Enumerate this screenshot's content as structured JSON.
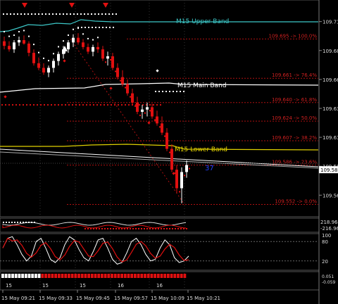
{
  "chart_data": {
    "type": "candlestick",
    "symbol_timeframe": "M15 style indicator view",
    "price_axis": {
      "range": [
        109.545,
        109.725
      ],
      "ticks": [
        "109.710",
        "109.685",
        "109.660",
        "109.635",
        "109.610",
        "109.585",
        "109.560"
      ],
      "current_price_label": "109.582"
    },
    "bands": [
      {
        "name": "M15 Upper Band",
        "color": "#3cc7c7"
      },
      {
        "name": "M15 Main Band",
        "color": "#ffffff"
      },
      {
        "name": "M15 Lower Band",
        "color": "#e0d000"
      }
    ],
    "fib_levels": [
      {
        "label": "109.695 -> 100.0%",
        "price": 109.695
      },
      {
        "label": "109.661 -> 76.4%",
        "price": 109.661
      },
      {
        "label": "109.640 -> 61.8%",
        "price": 109.64
      },
      {
        "label": "109.624 -> 50.0%",
        "price": 109.624
      },
      {
        "label": "109.607 -> 38.2%",
        "price": 109.607
      },
      {
        "label": "109.586 -> 23.6%",
        "price": 109.586
      },
      {
        "label": "109.552 -> 0.0%",
        "price": 109.552
      }
    ],
    "annotation": "37",
    "candles": [
      [
        109.693,
        109.697,
        109.686,
        109.689
      ],
      [
        109.689,
        109.693,
        109.684,
        109.686
      ],
      [
        109.686,
        109.694,
        109.683,
        109.692
      ],
      [
        109.692,
        109.697,
        109.689,
        109.694
      ],
      [
        109.694,
        109.698,
        109.69,
        109.691
      ],
      [
        109.691,
        109.693,
        109.68,
        109.683
      ],
      [
        109.683,
        109.686,
        109.672,
        109.674
      ],
      [
        109.674,
        109.679,
        109.668,
        109.67
      ],
      [
        109.67,
        109.674,
        109.664,
        109.666
      ],
      [
        109.666,
        109.672,
        109.662,
        109.67
      ],
      [
        109.67,
        109.678,
        109.666,
        109.676
      ],
      [
        109.676,
        109.684,
        109.672,
        109.682
      ],
      [
        109.682,
        109.689,
        109.678,
        109.686
      ],
      [
        109.686,
        109.694,
        109.683,
        109.692
      ],
      [
        109.692,
        109.699,
        109.688,
        109.696
      ],
      [
        109.696,
        109.7,
        109.69,
        109.692
      ],
      [
        109.692,
        109.695,
        109.686,
        109.688
      ],
      [
        109.688,
        109.691,
        109.682,
        109.684
      ],
      [
        109.684,
        109.69,
        109.68,
        109.688
      ],
      [
        109.688,
        109.692,
        109.683,
        109.686
      ],
      [
        109.686,
        109.689,
        109.676,
        109.678
      ],
      [
        109.678,
        109.684,
        109.672,
        109.68
      ],
      [
        109.68,
        109.683,
        109.668,
        109.67
      ],
      [
        109.67,
        109.674,
        109.66,
        109.662
      ],
      [
        109.662,
        109.668,
        109.654,
        109.656
      ],
      [
        109.656,
        109.66,
        109.646,
        109.648
      ],
      [
        109.648,
        109.652,
        109.638,
        109.64
      ],
      [
        109.64,
        109.645,
        109.63,
        109.632
      ],
      [
        109.632,
        109.638,
        109.626,
        109.634
      ],
      [
        109.634,
        109.64,
        109.628,
        109.636
      ],
      [
        109.636,
        109.639,
        109.626,
        109.628
      ],
      [
        109.628,
        109.633,
        109.62,
        109.622
      ],
      [
        109.622,
        109.628,
        109.612,
        109.614
      ],
      [
        109.614,
        109.618,
        109.598,
        109.6
      ],
      [
        109.6,
        109.604,
        109.58,
        109.582
      ],
      [
        109.582,
        109.586,
        109.562,
        109.566
      ],
      [
        109.566,
        109.584,
        109.553,
        109.58
      ],
      [
        109.58,
        109.59,
        109.575,
        109.586
      ]
    ],
    "cci": {
      "labels": [
        "218.963",
        "-216.962"
      ]
    },
    "stochastic": {
      "levels": [
        "100",
        "80",
        "20"
      ]
    },
    "bottom_labels": [
      "0.051",
      "-0.059"
    ],
    "time_labels": [
      "15 May 09:21",
      "15 May 09:33",
      "15 May 09:45",
      "15 May 09:57",
      "15 May 10:09",
      "15 May 10:21"
    ],
    "day_labels": [
      "15",
      "15",
      "15",
      "16",
      "16"
    ]
  }
}
